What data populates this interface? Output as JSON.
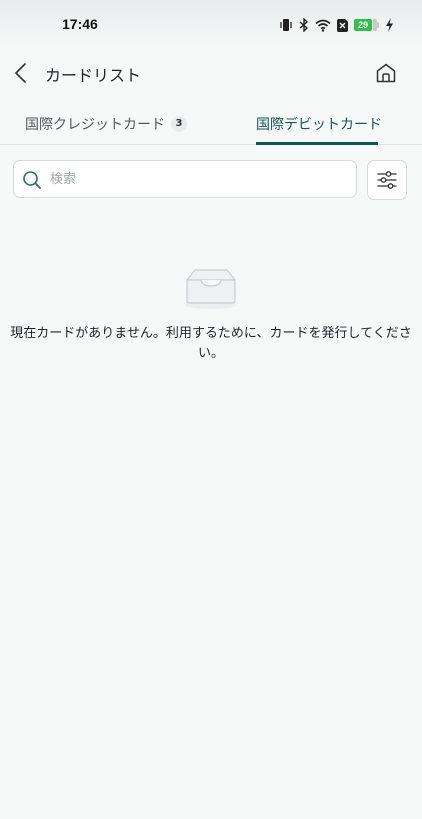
{
  "status_bar": {
    "time": "17:46",
    "battery_level": "29",
    "icons": [
      "vibrate-icon",
      "bluetooth-icon",
      "wifi-icon",
      "sim-disabled-icon",
      "battery-icon",
      "charging-icon"
    ]
  },
  "header": {
    "title": "カードリスト",
    "back_icon": "chevron-left-icon",
    "home_icon": "home-icon"
  },
  "tabs": [
    {
      "label": "国際クレジットカード",
      "badge": "3",
      "active": false
    },
    {
      "label": "国際デビットカード",
      "active": true
    }
  ],
  "search": {
    "placeholder": "検索",
    "value": ""
  },
  "empty_state": {
    "icon": "empty-inbox-icon",
    "message": "現在カードがありません。利用するために、カードを発行してください。"
  },
  "colors": {
    "accent": "#0f5a50",
    "background": "#f7f9f9",
    "battery": "#2fc04b"
  }
}
